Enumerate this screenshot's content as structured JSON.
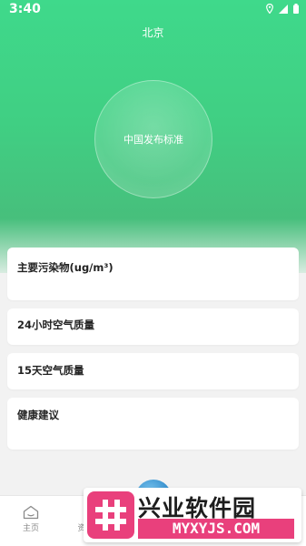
{
  "status_bar": {
    "time": "3:40"
  },
  "header": {
    "city": "北京",
    "standard_label": "中国发布标准"
  },
  "cards": {
    "pollutant_title": "主要污染物(ug/m³)",
    "aqi_24h_title": "24小时空气质量",
    "aqi_15d_title": "15天空气质量",
    "health_title": "健康建议"
  },
  "tabbar": {
    "home_label": "主页",
    "second_label": "资"
  },
  "watermark": {
    "name": "兴业软件园",
    "url": "MYXYJS.COM"
  },
  "colors": {
    "primary": "#40cf83",
    "watermark": "#e9407c"
  }
}
